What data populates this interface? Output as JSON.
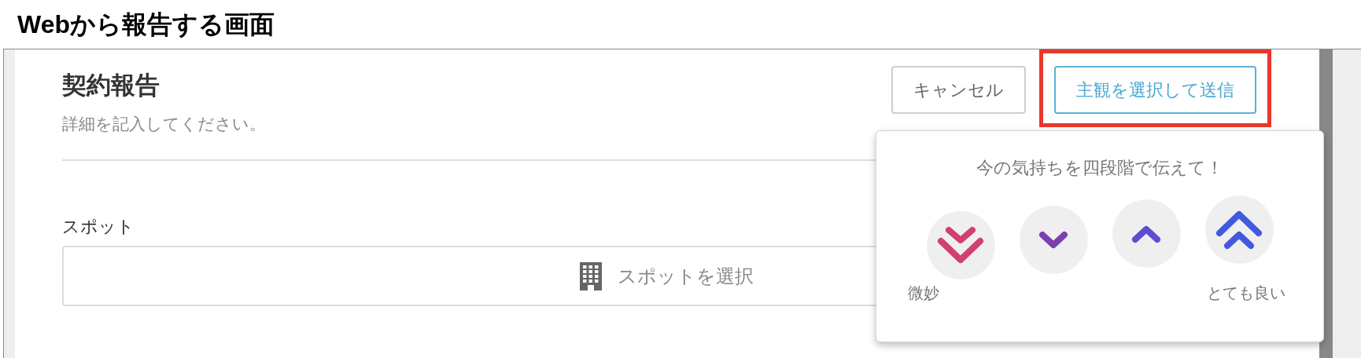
{
  "page_title": "Webから報告する画面",
  "form": {
    "title": "契約報告",
    "subtitle": "詳細を記入してください。",
    "buttons": [
      {
        "label": "キャンセル",
        "kind": "cancel",
        "highlighted": false
      },
      {
        "label": "主観を選択して送信",
        "kind": "primary",
        "highlighted": true
      }
    ],
    "fields": [
      {
        "label": "スポット",
        "placeholder": "スポットを選択"
      }
    ]
  },
  "popup": {
    "prompt": "今の気持ちを四段階で伝えて！",
    "options": [
      {
        "kind": "double-down",
        "color": "#d04070",
        "label": "微妙"
      },
      {
        "kind": "down",
        "color": "#7b3fb0"
      },
      {
        "kind": "up",
        "color": "#5a4fcf"
      },
      {
        "kind": "double-up",
        "color": "#4259df",
        "label": "とても良い"
      }
    ]
  }
}
